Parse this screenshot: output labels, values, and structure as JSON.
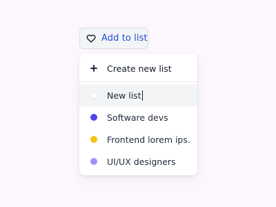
{
  "colors": {
    "background": "#fcf7fd",
    "button_text": "#1d4ed8",
    "active_row": "#f3f4f6"
  },
  "add_button": {
    "icon": "heart-icon",
    "label": "Add to list"
  },
  "menu": {
    "create_icon": "plus-icon",
    "create_label": "Create new list",
    "items": [
      {
        "label": "New list",
        "color": "#ffffff",
        "kind": "new-list-input",
        "active": true
      },
      {
        "label": "Software devs",
        "color": "#4f46e5"
      },
      {
        "label": "Frontend lorem ips…",
        "color": "#f5c211"
      },
      {
        "label": "UI/UX designers",
        "color": "#a78bfa"
      }
    ]
  }
}
